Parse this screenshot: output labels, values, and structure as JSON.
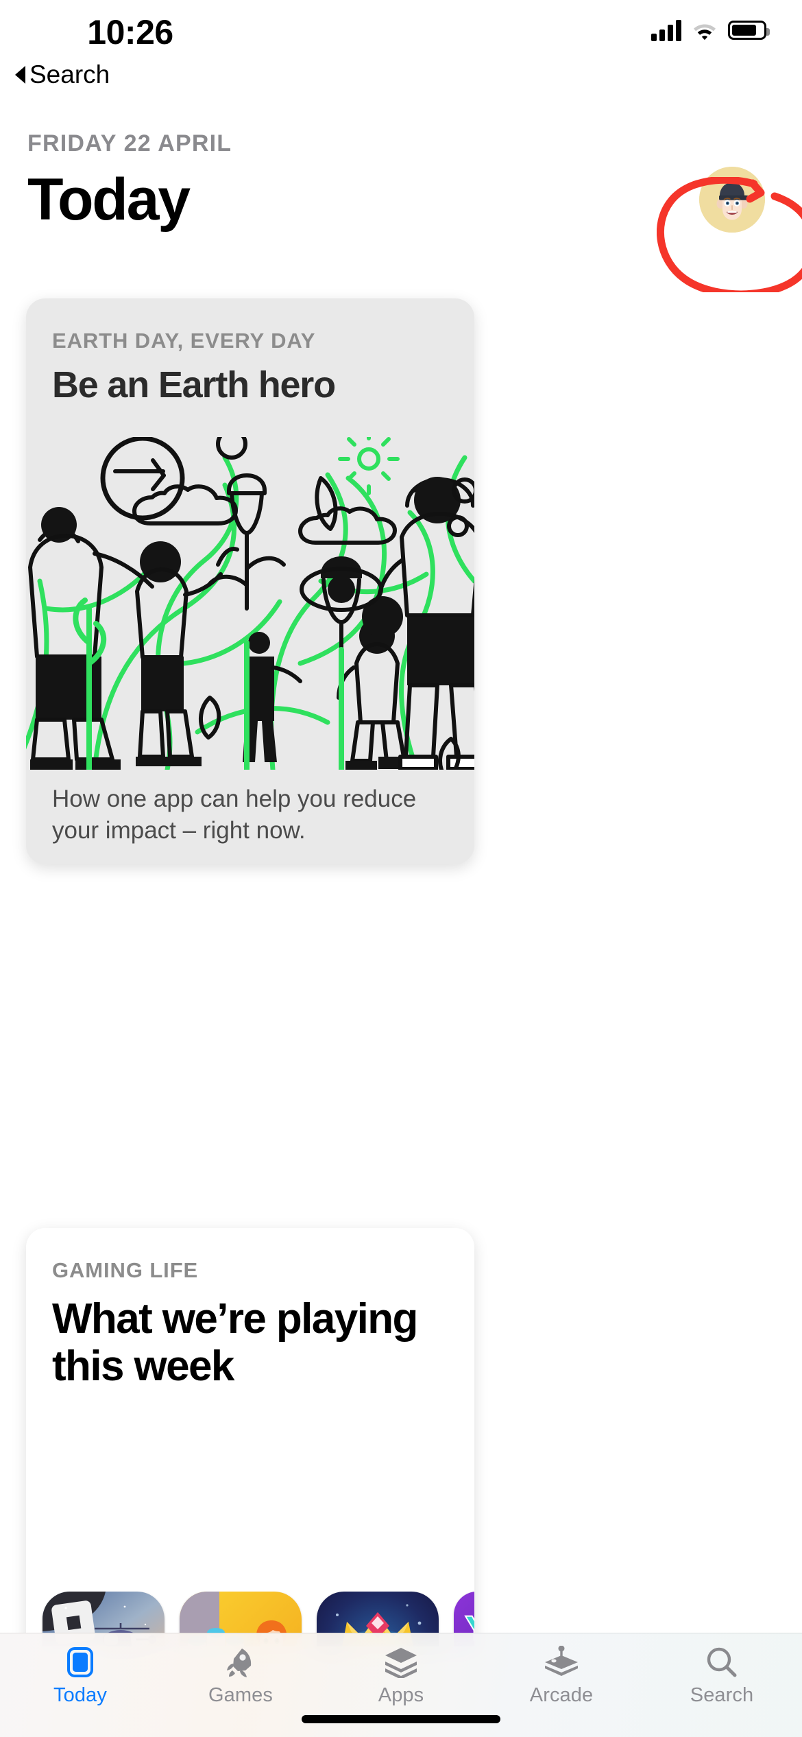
{
  "status_bar": {
    "time": "10:26",
    "signal_icon": "cellular-signal-icon",
    "wifi_icon": "wifi-icon",
    "battery_icon": "battery-icon"
  },
  "back_link": {
    "label": "Search",
    "icon": "back-caret-icon"
  },
  "header": {
    "date": "FRIDAY 22 APRIL",
    "title": "Today",
    "avatar_name": "memoji-avatar",
    "avatar_bg": "#f0dda0"
  },
  "annotation": {
    "shape": "hand-drawn-red-circle",
    "color": "#f5352a",
    "targets": "profile-avatar"
  },
  "cards": [
    {
      "id": "earth-day-card",
      "eyebrow": "EARTH DAY, EVERY DAY",
      "headline": "Be an Earth hero",
      "caption": "How one app can help you reduce your impact – right now.",
      "background": "#e9e9e9",
      "artwork": "earth-day-line-illustration",
      "accent": "#2fe05e"
    },
    {
      "id": "gaming-life-card",
      "eyebrow": "GAMING LIFE",
      "headline": "What we’re playing this week",
      "background": "#ffffff",
      "apps": [
        {
          "name": "roblox-app-icon",
          "bg": "#2b2b33"
        },
        {
          "name": "town-farm-game-app-icon",
          "bg": "#f5c21b"
        },
        {
          "name": "king-crown-game-app-icon",
          "bg": "#201b4a"
        },
        {
          "name": "yalla-ludo-app-icon",
          "bg": "#7b2fc4"
        }
      ]
    }
  ],
  "tab_bar": {
    "items": [
      {
        "label": "Today",
        "icon": "today-card-icon",
        "active": true
      },
      {
        "label": "Games",
        "icon": "rocket-icon",
        "active": false
      },
      {
        "label": "Apps",
        "icon": "layers-icon",
        "active": false
      },
      {
        "label": "Arcade",
        "icon": "joystick-icon",
        "active": false
      },
      {
        "label": "Search",
        "icon": "search-icon",
        "active": false
      }
    ],
    "active_color": "#0a7cff",
    "inactive_color": "#8e8e93"
  },
  "home_indicator": "home-indicator-bar"
}
